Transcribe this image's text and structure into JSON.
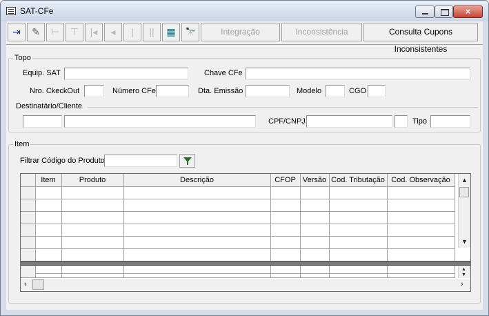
{
  "window": {
    "title": "SAT-CFe",
    "close_glyph": "×"
  },
  "toolbar": {
    "icons": [
      {
        "name": "exit-icon",
        "glyph": "⇥"
      },
      {
        "name": "eraser-icon",
        "glyph": "✎"
      },
      {
        "name": "branch-icon",
        "glyph": "⊢"
      },
      {
        "name": "branch-alt-icon",
        "glyph": "⊤"
      },
      {
        "name": "first-record-icon",
        "glyph": "|◂"
      },
      {
        "name": "prev-record-icon",
        "glyph": "◂"
      },
      {
        "name": "next-record-icon",
        "glyph": "|"
      },
      {
        "name": "pause-icon",
        "glyph": "||"
      },
      {
        "name": "spreadsheet-icon",
        "glyph": "▦"
      },
      {
        "name": "binoculars-icon",
        "glyph": "🔭"
      }
    ],
    "btn_integracao": "Integração",
    "btn_inconsistencia": "Inconsistência",
    "btn_consulta": "Consulta Cupons Inconsistentes"
  },
  "topo": {
    "legend": "Topo",
    "equip_sat": "Equip. SAT",
    "chave_cfe": "Chave CFe",
    "nro_checkout": "Nro. CkeckOut",
    "numero_cfe": "Número CFe",
    "dta_emissao": "Dta. Emissão",
    "modelo": "Modelo",
    "cgo": "CGO",
    "destinatario": "Destinatário/Cliente",
    "cpf_cnpj": "CPF/CNPJ",
    "tipo": "Tipo"
  },
  "item": {
    "legend": "Item",
    "filtrar": "Filtrar Código do Produto",
    "columns": [
      "Item",
      "Produto",
      "Descrição",
      "CFOP",
      "Versão",
      "Cod. Tributação",
      "Cod. Observação"
    ]
  }
}
